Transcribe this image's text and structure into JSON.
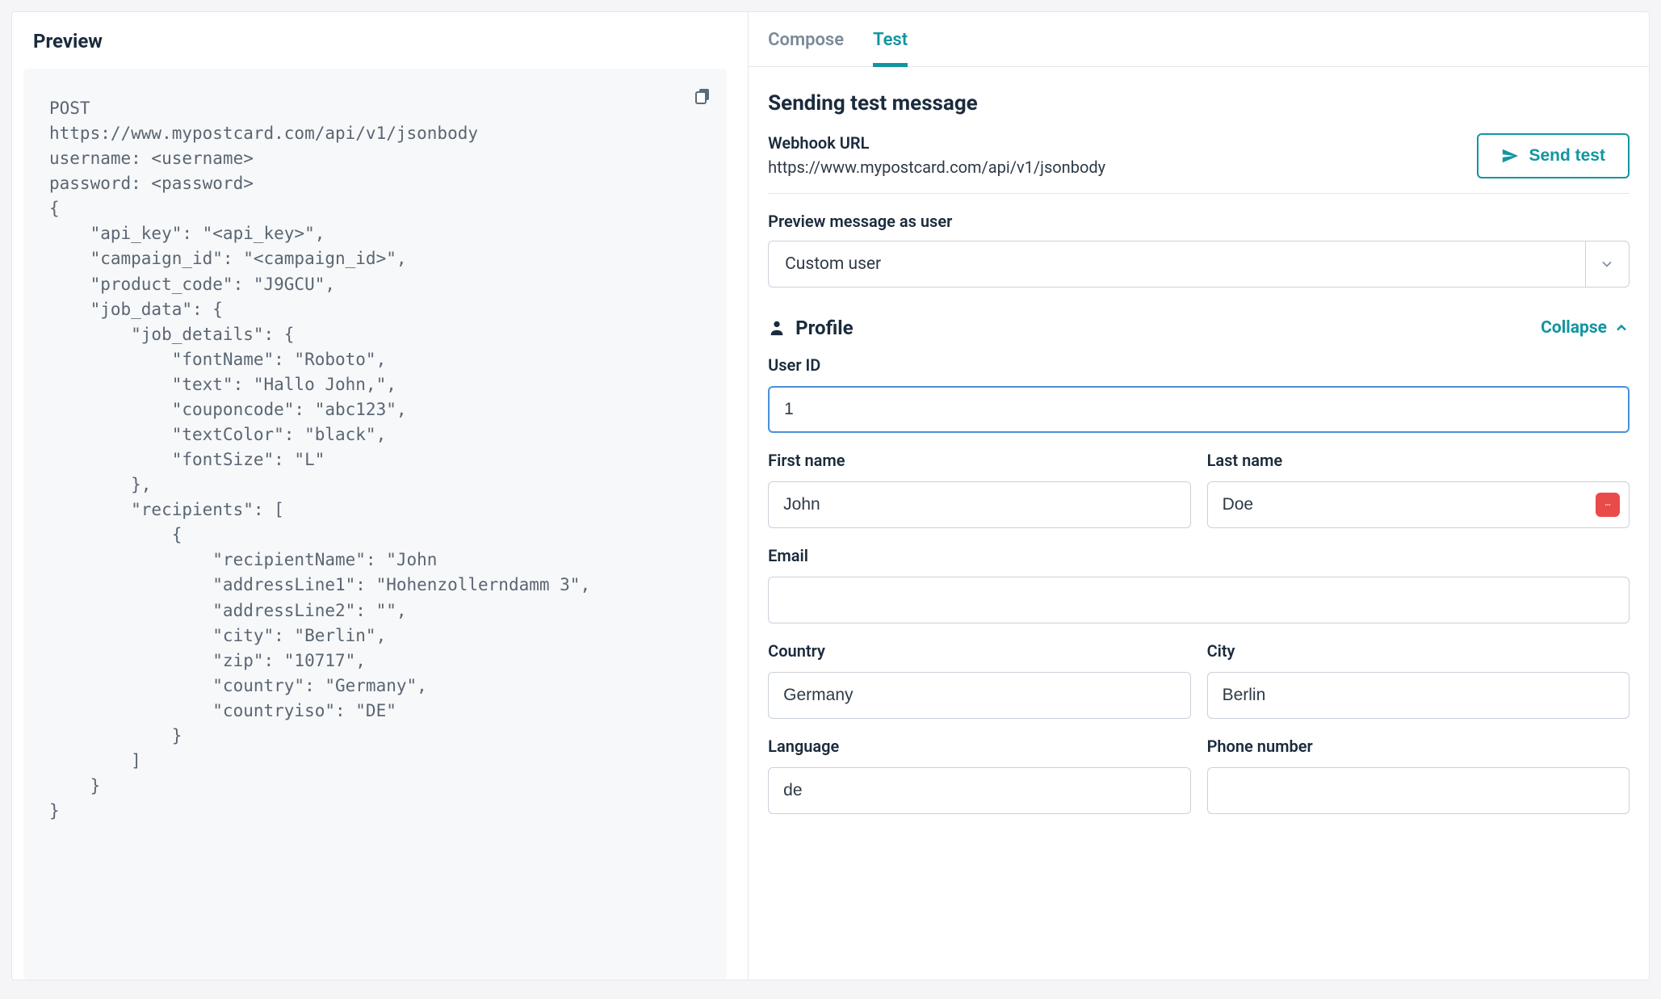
{
  "left": {
    "header": "Preview",
    "code": "POST\nhttps://www.mypostcard.com/api/v1/jsonbody\nusername: <username>\npassword: <password>\n{\n    \"api_key\": \"<api_key>\",\n    \"campaign_id\": \"<campaign_id>\",\n    \"product_code\": \"J9GCU\",\n    \"job_data\": {\n        \"job_details\": {\n            \"fontName\": \"Roboto\",\n            \"text\": \"Hallo John,\",\n            \"couponcode\": \"abc123\",\n            \"textColor\": \"black\",\n            \"fontSize\": \"L\"\n        },\n        \"recipients\": [\n            {\n                \"recipientName\": \"John\n                \"addressLine1\": \"Hohenzollerndamm 3\",\n                \"addressLine2\": \"\",\n                \"city\": \"Berlin\",\n                \"zip\": \"10717\",\n                \"country\": \"Germany\",\n                \"countryiso\": \"DE\"\n            }\n        ]\n    }\n}"
  },
  "tabs": {
    "compose": "Compose",
    "test": "Test"
  },
  "test": {
    "title": "Sending test message",
    "webhook_label": "Webhook URL",
    "webhook_url": "https://www.mypostcard.com/api/v1/jsonbody",
    "send_test": "Send test",
    "preview_as_label": "Preview message as user",
    "preview_as_value": "Custom user"
  },
  "profile": {
    "title": "Profile",
    "collapse": "Collapse",
    "fields": {
      "user_id_label": "User ID",
      "user_id": "1",
      "first_name_label": "First name",
      "first_name": "John",
      "last_name_label": "Last name",
      "last_name": "Doe",
      "email_label": "Email",
      "email": "",
      "country_label": "Country",
      "country": "Germany",
      "city_label": "City",
      "city": "Berlin",
      "language_label": "Language",
      "language": "de",
      "phone_label": "Phone number",
      "phone": ""
    }
  }
}
